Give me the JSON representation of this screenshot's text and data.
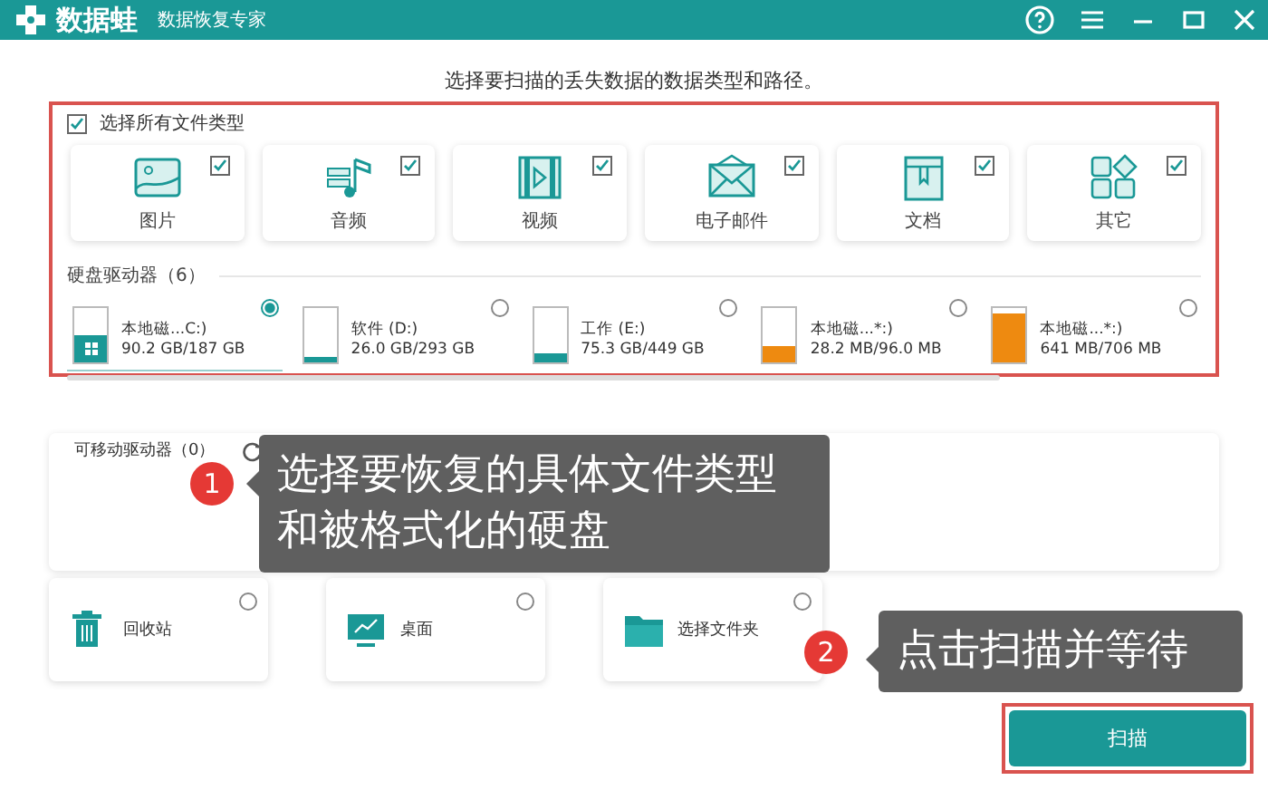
{
  "window": {
    "logo": "数据蛙",
    "subtitle": "数据恢复专家"
  },
  "heading": "选择要扫描的丢失数据的数据类型和路径。",
  "select_all": {
    "label": "选择所有文件类型",
    "checked": true
  },
  "file_types": [
    {
      "kind": "image",
      "label": "图片",
      "checked": true
    },
    {
      "kind": "audio",
      "label": "音频",
      "checked": true
    },
    {
      "kind": "video",
      "label": "视频",
      "checked": true
    },
    {
      "kind": "email",
      "label": "电子邮件",
      "checked": true
    },
    {
      "kind": "document",
      "label": "文档",
      "checked": true
    },
    {
      "kind": "other",
      "label": "其它",
      "checked": true
    }
  ],
  "hard_drives": {
    "title": "硬盘驱动器（6）",
    "items": [
      {
        "name": "本地磁...C:)",
        "size": "90.2 GB/187 GB",
        "level": 0.5,
        "color": "#1a9896",
        "system": true,
        "selected": true
      },
      {
        "name": "软件 (D:)",
        "size": "26.0 GB/293 GB",
        "level": 0.09,
        "color": "#1a9896",
        "system": false,
        "selected": false
      },
      {
        "name": "工作 (E:)",
        "size": "75.3 GB/449 GB",
        "level": 0.17,
        "color": "#1a9896",
        "system": false,
        "selected": false
      },
      {
        "name": "本地磁...*:)",
        "size": "28.2 MB/96.0 MB",
        "level": 0.3,
        "color": "#ee8a10",
        "system": false,
        "selected": false
      },
      {
        "name": "本地磁...*:)",
        "size": "641 MB/706 MB",
        "level": 0.9,
        "color": "#ee8a10",
        "system": false,
        "selected": false
      }
    ]
  },
  "removable_drives": {
    "title": "可移动驱动器（0）"
  },
  "locations": [
    {
      "kind": "recycle",
      "label": "回收站",
      "selected": false
    },
    {
      "kind": "desktop",
      "label": "桌面",
      "selected": false
    },
    {
      "kind": "folder",
      "label": "选择文件夹",
      "selected": false
    }
  ],
  "scan_button": "扫描",
  "callouts": [
    {
      "number": "1",
      "text": "选择要恢复的具体文件类型和被格式化的硬盘"
    },
    {
      "number": "2",
      "text": "点击扫描并等待"
    }
  ]
}
